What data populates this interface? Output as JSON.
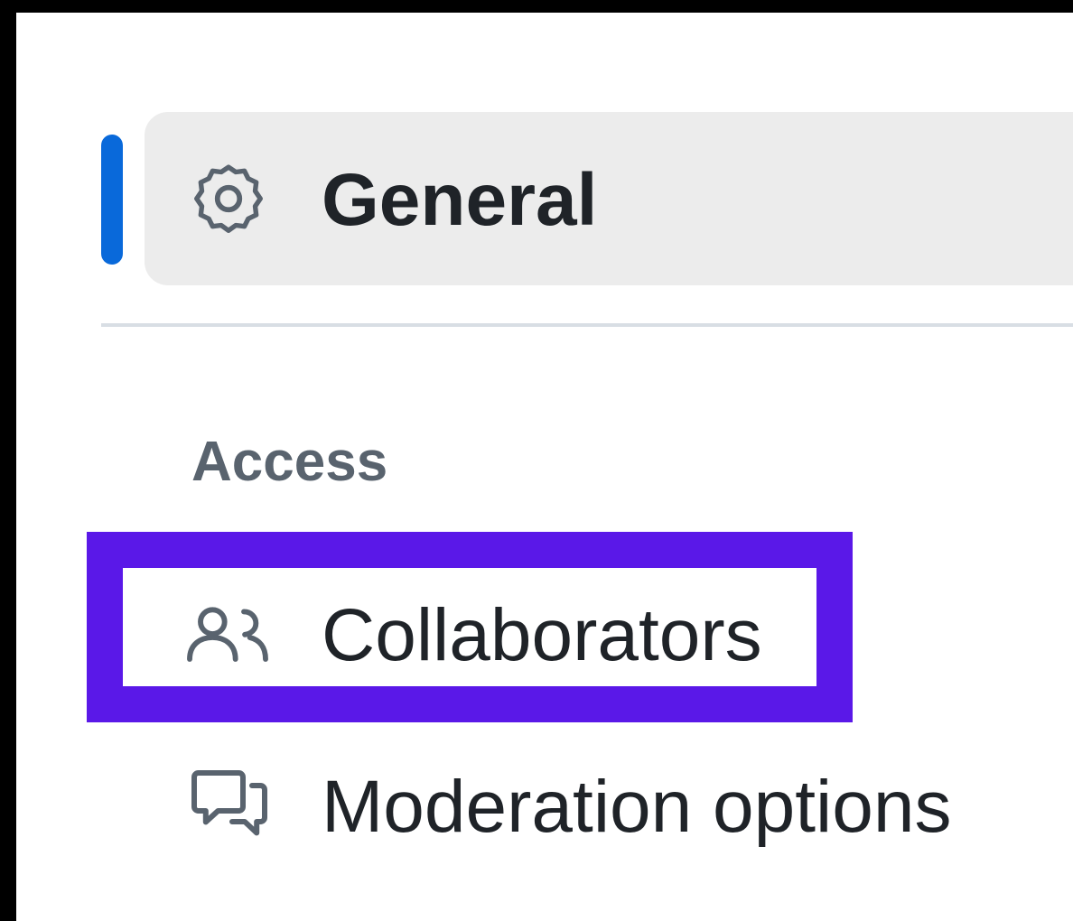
{
  "sidebar": {
    "items": [
      {
        "label": "General",
        "icon": "gear-icon",
        "active": true
      }
    ],
    "sections": [
      {
        "heading": "Access",
        "items": [
          {
            "label": "Collaborators",
            "icon": "people-icon",
            "highlighted": true
          },
          {
            "label": "Moderation options",
            "icon": "comment-discussion-icon"
          }
        ]
      }
    ]
  },
  "colors": {
    "active_indicator": "#0969da",
    "active_background": "#ececec",
    "highlight_border": "#5a18e8",
    "text_primary": "#1f2328",
    "text_muted": "#59636e",
    "divider": "#d8dee4"
  }
}
